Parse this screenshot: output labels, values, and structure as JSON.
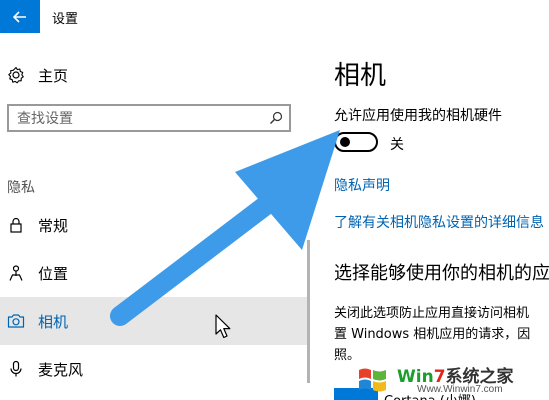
{
  "window": {
    "title": "设置"
  },
  "sidebar": {
    "home_label": "主页",
    "search_placeholder": "查找设置",
    "section_label": "隐私",
    "items": [
      {
        "label": "常规",
        "icon": "lock-icon",
        "selected": false
      },
      {
        "label": "位置",
        "icon": "location-icon",
        "selected": false
      },
      {
        "label": "相机",
        "icon": "camera-icon",
        "selected": true
      },
      {
        "label": "麦克风",
        "icon": "microphone-icon",
        "selected": false
      }
    ]
  },
  "main": {
    "title": "相机",
    "allow_label": "允许应用使用我的相机硬件",
    "toggle_state": "关",
    "toggle_on": false,
    "privacy_link": "隐私声明",
    "learn_more_link": "了解有关相机隐私设置的详细信息",
    "section_heading": "选择能够使用你的相机的应用",
    "description_lines": [
      "关闭此选项防止应用直接访问相机",
      "置 Windows 相机应用的请求，因",
      "照。"
    ],
    "first_app_name": "Cortana (小娜)"
  },
  "watermark": {
    "title_part1": "Win",
    "title_part2": "7",
    "title_part3": "系统之家",
    "url": "Www.Winwin7.com"
  },
  "colors": {
    "accent": "#0078d7",
    "link": "#0063b1",
    "selected_bg": "#e6e6e6",
    "arrow": "#3d9be9"
  }
}
